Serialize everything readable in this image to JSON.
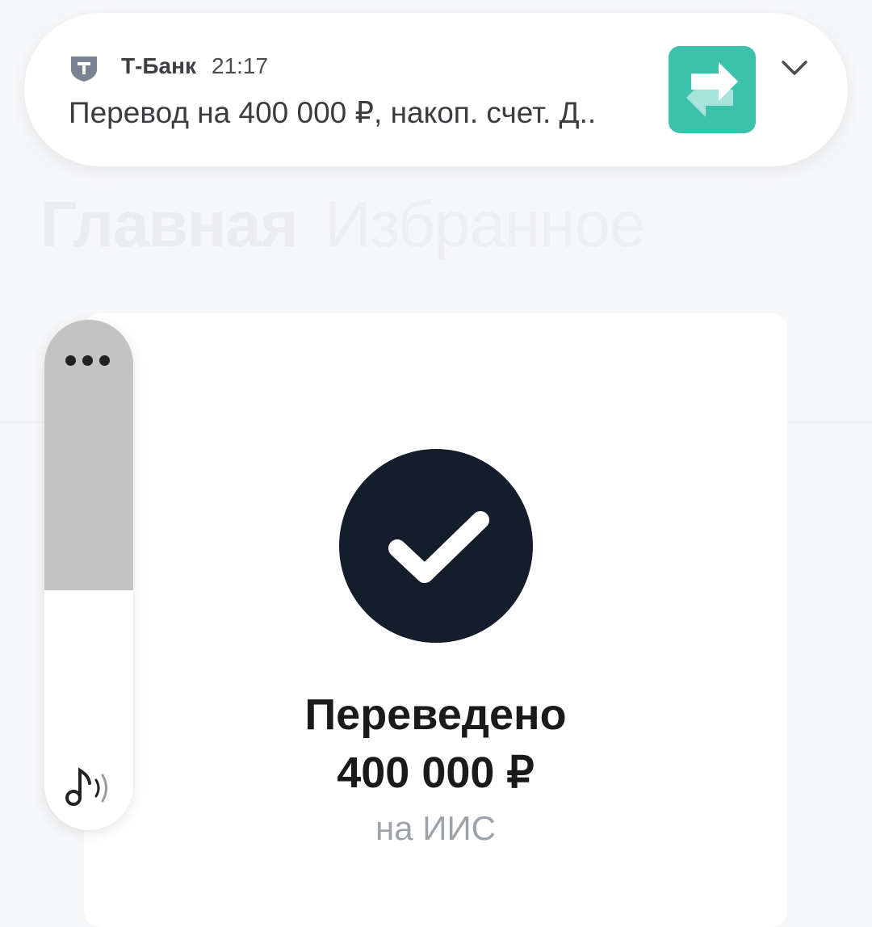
{
  "notification": {
    "app_name": "Т-Банк",
    "time": "21:17",
    "text": "Перевод на 400 000 ₽, накоп. счет. Д..",
    "brand_color": "#3cc1ad",
    "app_icon": "shield-t-icon",
    "thumbnail_icon": "transfer-arrows-icon",
    "expand_icon": "chevron-down-icon"
  },
  "background": {
    "tabs": [
      "Главная",
      "Избранное"
    ]
  },
  "card": {
    "icon": "checkmark-icon",
    "title": "Переведено",
    "amount": "400 000 ₽",
    "destination": "на ИИС"
  },
  "volume": {
    "level": 0.47,
    "more_icon": "more-dots-icon",
    "stream_icon": "media-sound-icon"
  }
}
